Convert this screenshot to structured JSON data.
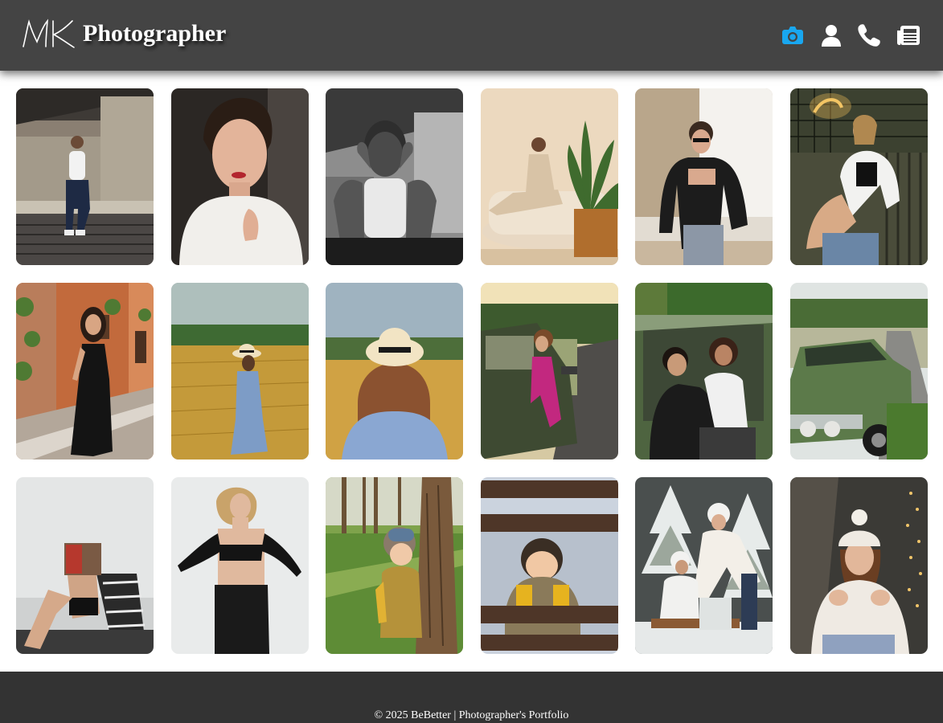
{
  "header": {
    "logo_alt": "MK",
    "title": "Photographer",
    "nav": [
      {
        "icon": "camera-icon",
        "color": "#19a7f0",
        "active": true
      },
      {
        "icon": "user-icon",
        "color": "#ffffff",
        "active": false
      },
      {
        "icon": "phone-icon",
        "color": "#ffffff",
        "active": false
      },
      {
        "icon": "newspaper-icon",
        "color": "#ffffff",
        "active": false
      }
    ]
  },
  "gallery": {
    "photos": [
      {
        "subject": "man-on-stairs"
      },
      {
        "subject": "woman-white-shirt-portrait"
      },
      {
        "subject": "man-hands-on-face-bw"
      },
      {
        "subject": "woman-on-sofa-with-plant"
      },
      {
        "subject": "woman-black-jacket-window"
      },
      {
        "subject": "woman-sitting-neon-light"
      },
      {
        "subject": "woman-black-dress-street"
      },
      {
        "subject": "woman-hat-wheat-field"
      },
      {
        "subject": "woman-hat-back-field"
      },
      {
        "subject": "woman-leaning-on-car-road"
      },
      {
        "subject": "couple-in-car"
      },
      {
        "subject": "vintage-green-car"
      },
      {
        "subject": "woman-reading-magazine-bench"
      },
      {
        "subject": "woman-black-lingerie-gloves"
      },
      {
        "subject": "child-by-tree-park"
      },
      {
        "subject": "child-behind-fence"
      },
      {
        "subject": "winter-couple-sled"
      },
      {
        "subject": "woman-knit-hat-lights"
      }
    ]
  },
  "footer": {
    "text": "© 2025 BeBetter | Photographer's Portfolio"
  },
  "colors": {
    "header_bg": "#444444",
    "footer_bg": "#333333",
    "accent": "#19a7f0"
  }
}
